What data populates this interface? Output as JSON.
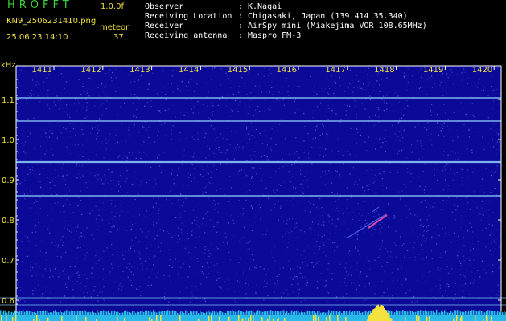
{
  "header": {
    "app_title": "HROFFT",
    "version": "1.0.0f",
    "filename": "KN9_2506231410.png",
    "datetime": "25.06.23 14:10",
    "meteor_label": "meteor",
    "meteor_count": "37",
    "info": [
      {
        "label": "Observer",
        "value": "K.Nagai"
      },
      {
        "label": "Receiving Location",
        "value": "Chigasaki, Japan (139.414 35.340)"
      },
      {
        "label": "Receiver",
        "value": "AirSpy mini (Miakejima VOR 108.65MHz)"
      },
      {
        "label": "Receiving antenna",
        "value": "Maspro FM-3"
      }
    ]
  },
  "spectrogram": {
    "y_unit": "kHz",
    "x_ticks": [
      "1411",
      "1412",
      "1413",
      "1414",
      "1415",
      "1416",
      "1417",
      "1418",
      "1419",
      "1420"
    ],
    "y_ticks": [
      "1.1",
      "1.0",
      "0.9",
      "0.8",
      "0.7",
      "0.6"
    ],
    "colors": {
      "background": "#0a0a96",
      "noise": "#4d58e0",
      "carrier": "#8fd0ff",
      "axis": "#ffffff",
      "label": "#f0e040",
      "meteor": "#e24aa6",
      "baseline": "#29b9e8",
      "peak": "#f5e23c"
    }
  }
}
